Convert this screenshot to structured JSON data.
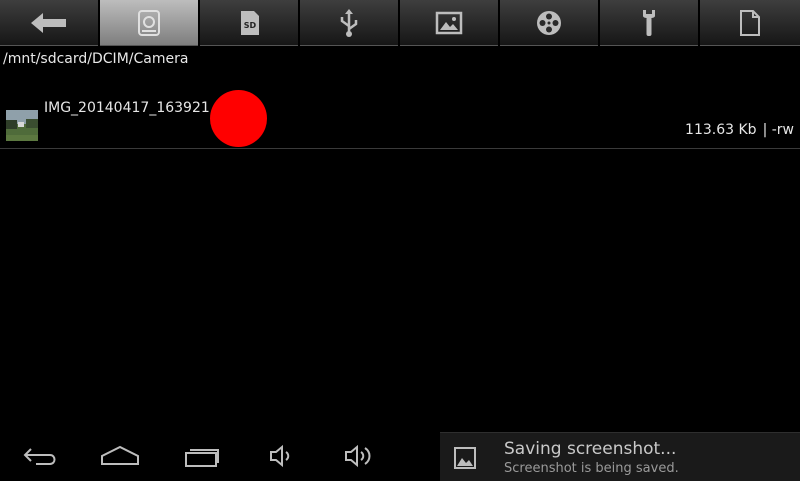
{
  "toolbar": {
    "buttons": [
      {
        "icon": "back-arrow-icon",
        "active": false
      },
      {
        "icon": "internal-storage-icon",
        "active": true
      },
      {
        "icon": "sd-card-icon",
        "active": false,
        "label": "SD"
      },
      {
        "icon": "usb-icon",
        "active": false
      },
      {
        "icon": "image-icon",
        "active": false
      },
      {
        "icon": "film-reel-icon",
        "active": false
      },
      {
        "icon": "wrench-icon",
        "active": false
      },
      {
        "icon": "document-icon",
        "active": false
      }
    ]
  },
  "path": "/mnt/sdcard/DCIM/Camera",
  "files": [
    {
      "name": "IMG_20140417_163921",
      "size": "113.63 Kb",
      "perms": "| -rw",
      "icon": "image-thumbnail"
    }
  ],
  "navbar": {
    "buttons": [
      "back-icon",
      "home-icon",
      "recent-apps-icon",
      "volume-down-icon",
      "volume-up-icon"
    ]
  },
  "notification": {
    "icon": "gallery-icon",
    "title": "Saving screenshot...",
    "subtitle": "Screenshot is being saved."
  },
  "colors": {
    "touch_indicator": "#ff0000",
    "toolbar_active": "#9e9e9e",
    "background": "#000000"
  }
}
